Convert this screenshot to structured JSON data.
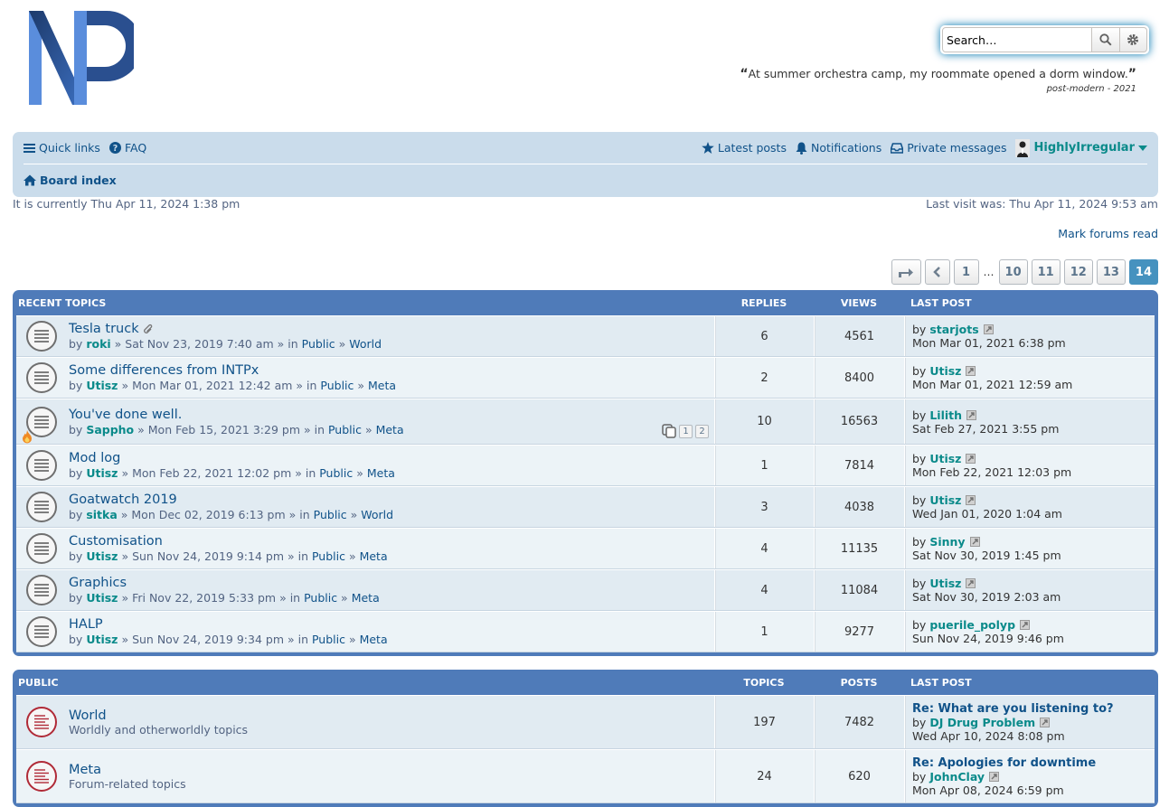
{
  "header": {
    "search_placeholder": "Search…",
    "quote": "At summer orchestra camp, my roommate opened a dorm window.",
    "quote_open": "“",
    "quote_close": "”",
    "quote_author": "post-modern - 2021"
  },
  "nav": {
    "quick_links": "Quick links",
    "faq": "FAQ",
    "latest_posts": "Latest posts",
    "notifications": "Notifications",
    "private_messages": "Private messages",
    "username": "HighlyIrregular",
    "board_index": "Board index"
  },
  "status": {
    "current_time": "It is currently Thu Apr 11, 2024 1:38 pm",
    "last_visit": "Last visit was: Thu Apr 11, 2024 9:53 am",
    "mark_read": "Mark forums read"
  },
  "pagination": {
    "pages": [
      "1",
      "10",
      "11",
      "12",
      "13",
      "14"
    ],
    "ellipsis": "…",
    "current": "14"
  },
  "recent": {
    "heading": "Recent topics",
    "col_replies": "Replies",
    "col_views": "Views",
    "col_last": "Last post",
    "topics": [
      {
        "title": "Tesla truck",
        "by": "by",
        "author": "roki",
        "date": "Sat Nov 23, 2019 7:40 am",
        "forum": "Public",
        "sub": "World",
        "replies": "6",
        "views": "4561",
        "lp_author": "starjots",
        "lp_date": "Mon Mar 01, 2021 6:38 pm"
      },
      {
        "title": "Some differences from INTPx",
        "by": "by",
        "author": "Utisz",
        "date": "Mon Mar 01, 2021 12:42 am",
        "forum": "Public",
        "sub": "Meta",
        "replies": "2",
        "views": "8400",
        "lp_author": "Utisz",
        "lp_date": "Mon Mar 01, 2021 12:59 am"
      },
      {
        "title": "You've done well.",
        "by": "by",
        "author": "Sappho",
        "date": "Mon Feb 15, 2021 3:29 pm",
        "forum": "Public",
        "sub": "Meta",
        "replies": "10",
        "views": "16563",
        "lp_author": "Lilith",
        "lp_date": "Sat Feb 27, 2021 3:55 pm",
        "mini_pages": [
          "1",
          "2"
        ]
      },
      {
        "title": "Mod log",
        "by": "by",
        "author": "Utisz",
        "date": "Mon Feb 22, 2021 12:02 pm",
        "forum": "Public",
        "sub": "Meta",
        "replies": "1",
        "views": "7814",
        "lp_author": "Utisz",
        "lp_date": "Mon Feb 22, 2021 12:03 pm"
      },
      {
        "title": "Goatwatch 2019",
        "by": "by",
        "author": "sitka",
        "date": "Mon Dec 02, 2019 6:13 pm",
        "forum": "Public",
        "sub": "World",
        "replies": "3",
        "views": "4038",
        "lp_author": "Utisz",
        "lp_date": "Wed Jan 01, 2020 1:04 am"
      },
      {
        "title": "Customisation",
        "by": "by",
        "author": "Utisz",
        "date": "Sun Nov 24, 2019 9:14 pm",
        "forum": "Public",
        "sub": "Meta",
        "replies": "4",
        "views": "11135",
        "lp_author": "Sinny",
        "lp_date": "Sat Nov 30, 2019 1:45 pm"
      },
      {
        "title": "Graphics",
        "by": "by",
        "author": "Utisz",
        "date": "Fri Nov 22, 2019 5:33 pm",
        "forum": "Public",
        "sub": "Meta",
        "replies": "4",
        "views": "11084",
        "lp_author": "Utisz",
        "lp_date": "Sat Nov 30, 2019 2:03 am"
      },
      {
        "title": "HALP",
        "by": "by",
        "author": "Utisz",
        "date": "Sun Nov 24, 2019 9:34 pm",
        "forum": "Public",
        "sub": "Meta",
        "replies": "1",
        "views": "9277",
        "lp_author": "puerile_polyp",
        "lp_date": "Sun Nov 24, 2019 9:46 pm"
      }
    ]
  },
  "public": {
    "heading": "Public",
    "col_topics": "Topics",
    "col_posts": "Posts",
    "col_last": "Last post",
    "forums": [
      {
        "title": "World",
        "desc": "Worldly and otherworldly topics",
        "topics": "197",
        "posts": "7482",
        "lp_title": "Re: What are you listening to?",
        "by": "by",
        "lp_author": "DJ Drug Problem",
        "lp_date": "Wed Apr 10, 2024 8:08 pm"
      },
      {
        "title": "Meta",
        "desc": "Forum-related topics",
        "topics": "24",
        "posts": "620",
        "lp_title": "Re: Apologies for downtime",
        "by": "by",
        "lp_author": "JohnClay",
        "lp_date": "Mon Apr 08, 2024 6:59 pm"
      }
    ]
  },
  "colors": {
    "block_header": "#4f7bb9",
    "navbar": "#cadceb",
    "link": "#105289",
    "username": "#0a8a8a",
    "active_page": "#4692bf"
  },
  "icons": [
    "logo-np",
    "search-icon",
    "gear-icon",
    "hamburger-icon",
    "question-icon",
    "star-icon",
    "bell-icon",
    "inbox-icon",
    "avatar",
    "caret-down-icon",
    "home-icon",
    "jump-to-icon",
    "chevron-left-icon",
    "topic-read-icon",
    "forum-unread-icon",
    "attachment-icon",
    "hot-topic-icon",
    "view-latest-icon"
  ]
}
